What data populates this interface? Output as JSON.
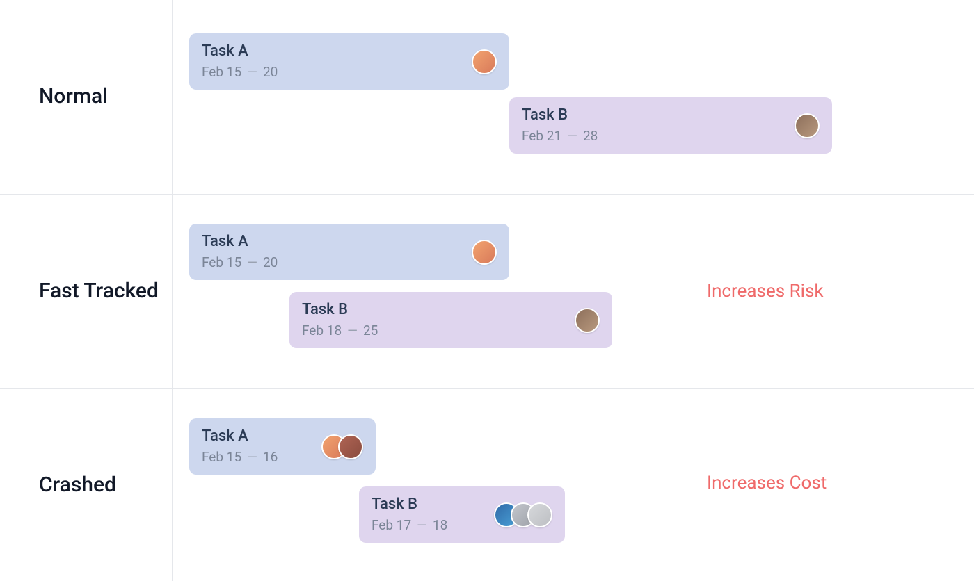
{
  "rows": [
    {
      "key": "normal",
      "label": "Normal",
      "note": null,
      "tasks": [
        {
          "key": "a",
          "title": "Task A",
          "date_prefix": "Feb 15",
          "date_suffix": "20"
        },
        {
          "key": "b",
          "title": "Task B",
          "date_prefix": "Feb 21",
          "date_suffix": "28"
        }
      ]
    },
    {
      "key": "fast",
      "label": "Fast Tracked",
      "note": "Increases Risk",
      "tasks": [
        {
          "key": "a",
          "title": "Task A",
          "date_prefix": "Feb 15",
          "date_suffix": "20"
        },
        {
          "key": "b",
          "title": "Task B",
          "date_prefix": "Feb 18",
          "date_suffix": "25"
        }
      ]
    },
    {
      "key": "crashed",
      "label": "Crashed",
      "note": "Increases Cost",
      "tasks": [
        {
          "key": "a",
          "title": "Task A",
          "date_prefix": "Feb 15",
          "date_suffix": "16"
        },
        {
          "key": "b",
          "title": "Task B",
          "date_prefix": "Feb 17",
          "date_suffix": "18"
        }
      ]
    }
  ],
  "date_separator": "—"
}
